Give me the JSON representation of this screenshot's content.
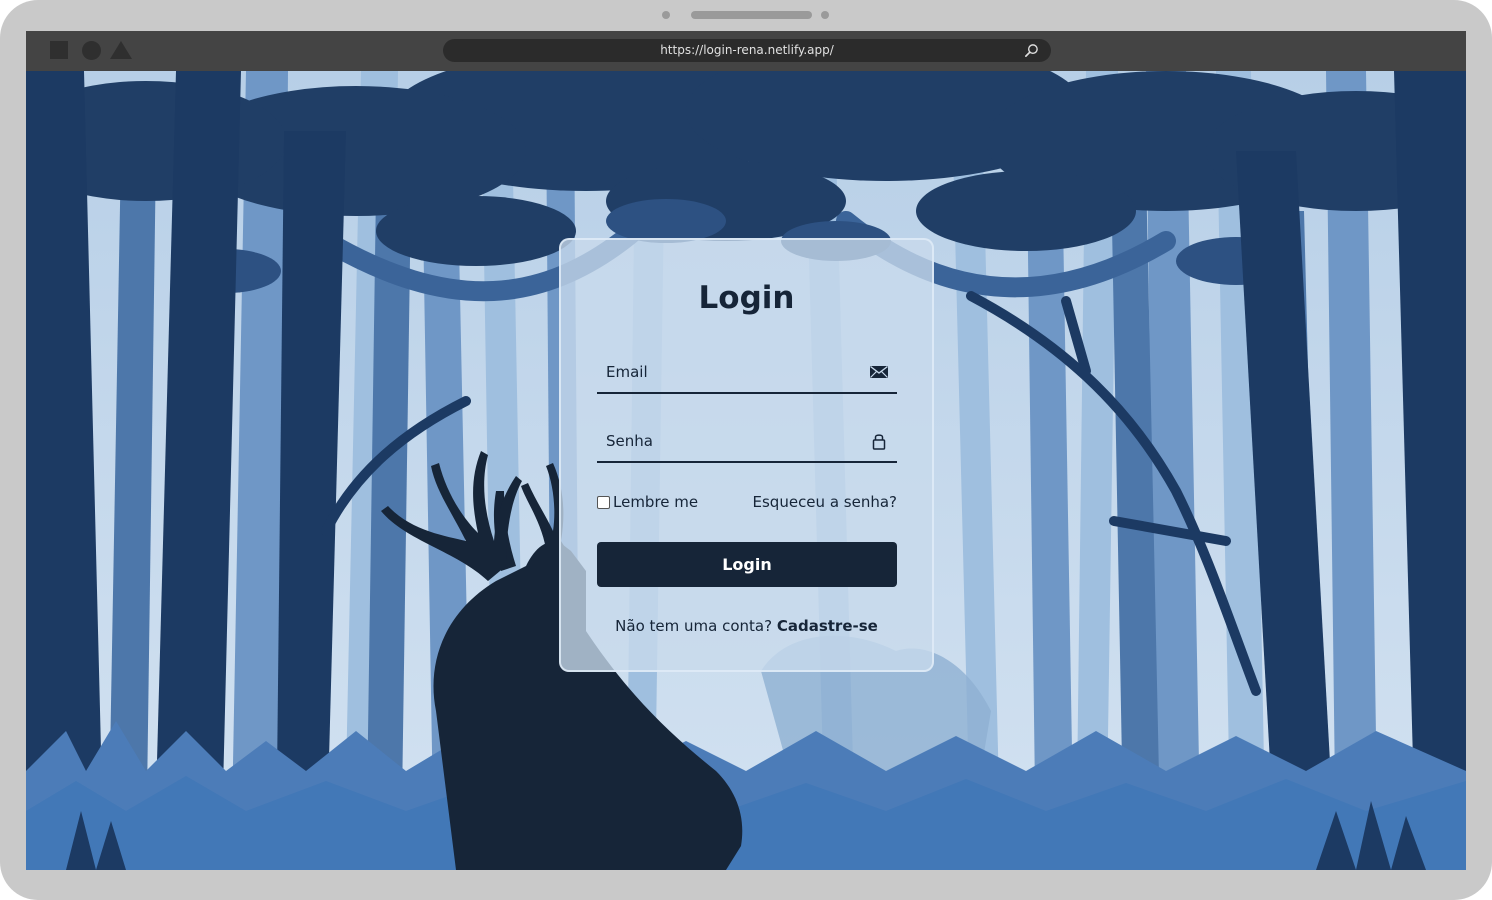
{
  "browser": {
    "url": "https://login-rena.netlify.app/"
  },
  "login": {
    "title": "Login",
    "email_placeholder": "Email",
    "password_placeholder": "Senha",
    "remember_label": "Lembre me",
    "forgot_label": "Esqueceu a senha?",
    "button_label": "Login",
    "no_account_text": "Não tem uma conta?",
    "register_label": "Cadastre-se"
  },
  "icons": {
    "email": "envelope-icon",
    "password": "lock-icon",
    "search": "search-icon"
  },
  "colors": {
    "primary": "#162538",
    "card": "#c8daec",
    "sky": "#c3d7ea",
    "browser_bar": "#444444"
  }
}
